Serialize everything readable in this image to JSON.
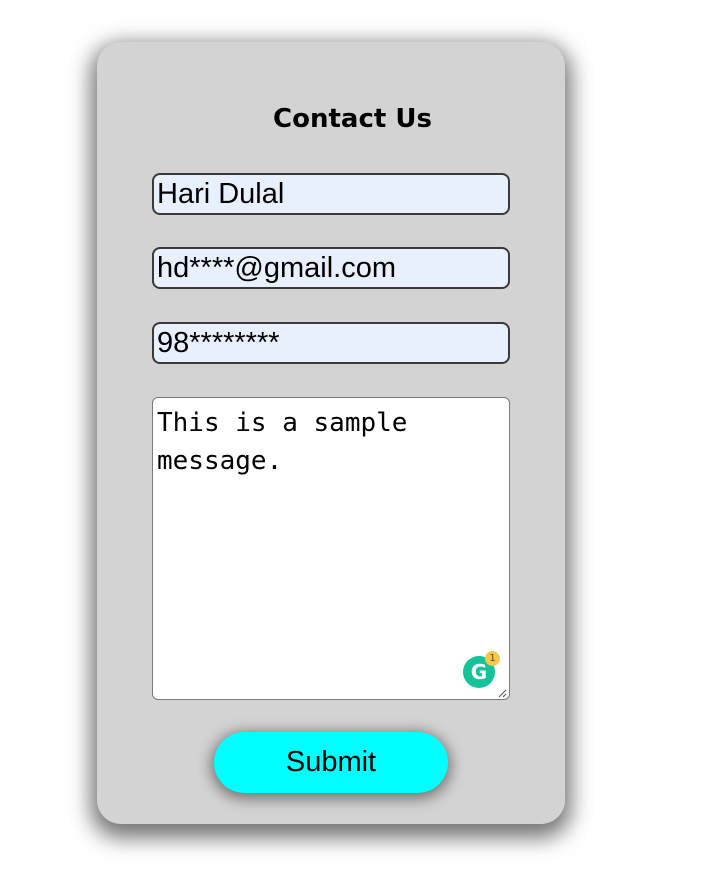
{
  "form": {
    "title": "Contact Us",
    "name_value": "Hari Dulal",
    "email_value": "hd****@gmail.com",
    "phone_value": "98********",
    "message_value": "This is a sample message.",
    "submit_label": "Submit"
  },
  "grammarly": {
    "icon": "grammarly-icon",
    "glyph": "G",
    "badge_count": "1"
  },
  "colors": {
    "card_background": "#d3d3d3",
    "input_background": "#e8f0fe",
    "submit_background": "#00ffff",
    "grammarly_green": "#15c39a"
  }
}
